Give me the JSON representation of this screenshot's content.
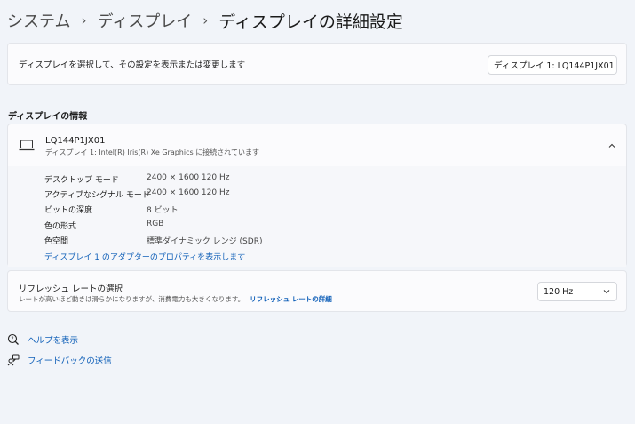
{
  "breadcrumb": {
    "items": [
      "システム",
      "ディスプレイ"
    ],
    "current": "ディスプレイの詳細設定"
  },
  "select_display": {
    "label": "ディスプレイを選択して、その設定を表示または変更します",
    "value": "ディスプレイ 1: LQ144P1JX01"
  },
  "info_section": {
    "heading": "ディスプレイの情報",
    "device_name": "LQ144P1JX01",
    "device_sub": "ディスプレイ 1: Intel(R) Iris(R) Xe Graphics に接続されています",
    "properties": [
      {
        "label": "デスクトップ モード",
        "value": "2400 × 1600 120 Hz"
      },
      {
        "label": "アクティブなシグナル モード",
        "value": "2400 × 1600 120 Hz"
      },
      {
        "label": "ビットの深度",
        "value": "8 ビット"
      },
      {
        "label": "色の形式",
        "value": "RGB"
      },
      {
        "label": "色空間",
        "value": "標準ダイナミック レンジ (SDR)"
      }
    ],
    "adapter_link": "ディスプレイ 1 のアダプターのプロパティを表示します"
  },
  "refresh": {
    "title": "リフレッシュ レートの選択",
    "description": "レートが高いほど動きは滑らかになりますが、消費電力も大きくなります。",
    "link": "リフレッシュ レートの詳細",
    "value": "120 Hz"
  },
  "links": {
    "help": "ヘルプを表示",
    "feedback": "フィードバックの送信"
  },
  "icons": {
    "laptop": "laptop-icon",
    "chevron_down": "chevron-down-icon",
    "chevron_up": "chevron-up-icon",
    "help": "help-icon",
    "feedback": "feedback-icon"
  },
  "colors": {
    "background": "#f1f4f9",
    "card": "#fbfbfd",
    "link": "#0f5fb8"
  }
}
